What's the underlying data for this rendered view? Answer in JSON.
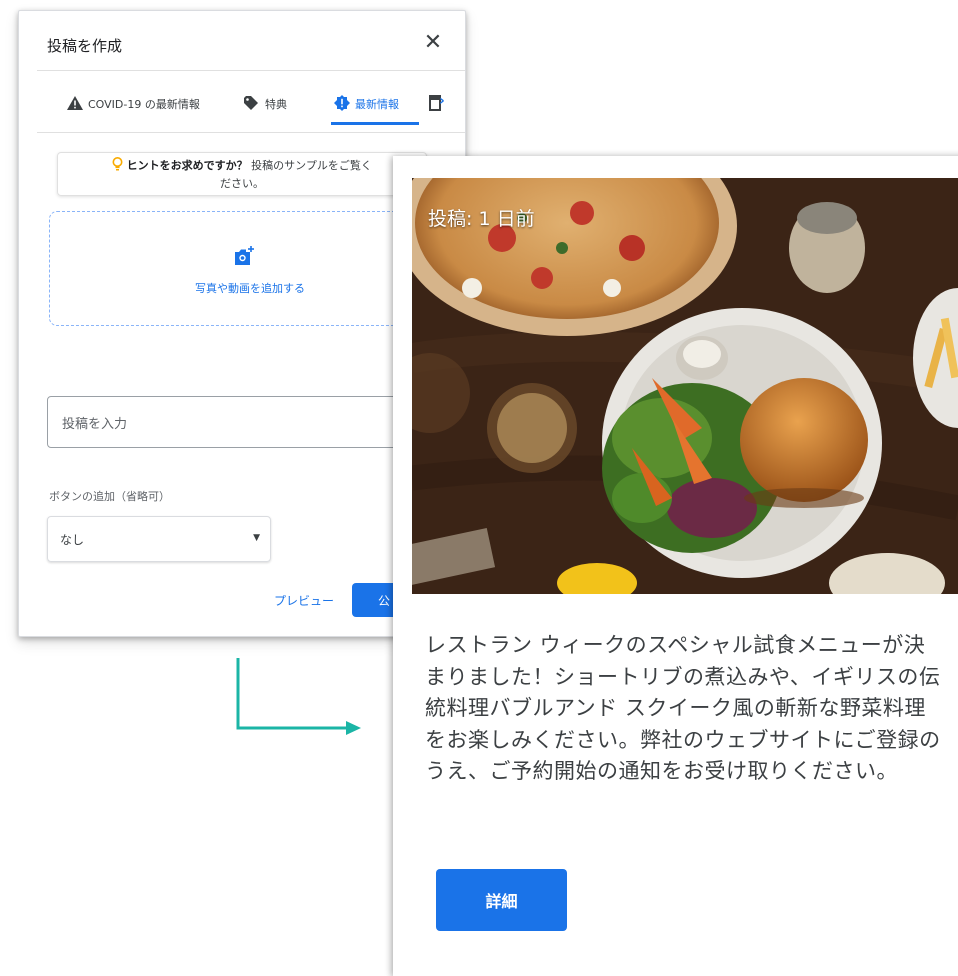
{
  "dialog": {
    "title": "投稿を作成",
    "close_icon": "close-icon",
    "tabs": [
      {
        "label": "COVID-19 の最新情報",
        "icon": "warning-icon",
        "active": false
      },
      {
        "label": "特典",
        "icon": "tag-icon",
        "active": false
      },
      {
        "label": "最新情報",
        "icon": "update-badge-icon",
        "active": true
      },
      {
        "label": "",
        "icon": "event-icon",
        "active": false
      }
    ],
    "hint": {
      "bold": "ヒントをお求めですか？",
      "link": "投稿のサンプルをご覧く",
      "cont": "ださい。"
    },
    "upload_label": "写真や動画を追加する",
    "post_placeholder": "投稿を入力",
    "button_section_label": "ボタンの追加（省略可）",
    "button_select_value": "なし",
    "preview_label": "プレビュー",
    "publish_label": "公"
  },
  "card": {
    "post_time": "投稿: 1 日前",
    "body_text": "レストラン ウィークのスペシャル試食メニューが決まりました！ショートリブの煮込みや、イギリスの伝統料理バブルアンド スクイーク風の斬新な野菜料理をお楽しみください。弊社のウェブサイトにご登録のうえ、ご予約開始の通知をお受け取りください。",
    "detail_button": "詳細"
  },
  "colors": {
    "accent": "#1a73e8",
    "arrow": "#1bb5a6",
    "hint_bulb": "#f9ab00"
  }
}
